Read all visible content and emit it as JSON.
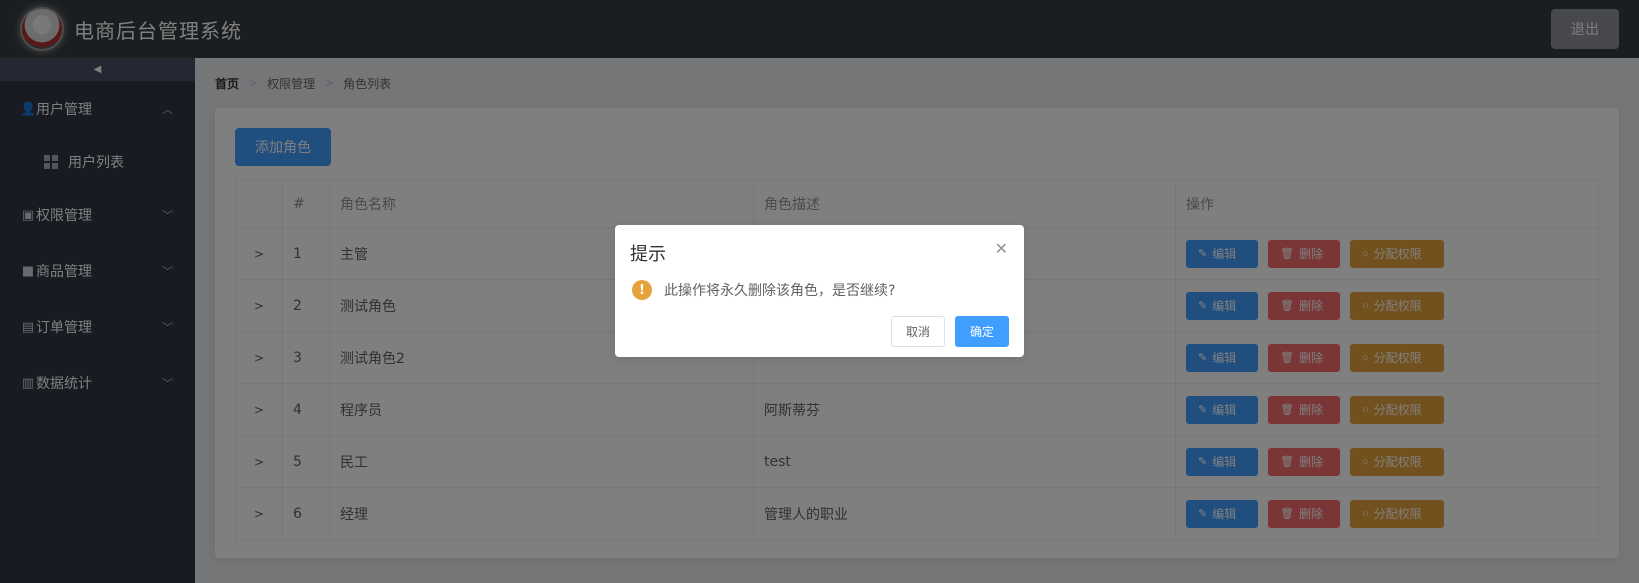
{
  "header": {
    "title": "电商后台管理系统",
    "logout_label": "退出"
  },
  "sidebar": {
    "collapse_icon": "caret-left-icon",
    "menus": [
      {
        "label": "用户管理",
        "icon": "user-icon",
        "expanded": true
      },
      {
        "label": "权限管理",
        "icon": "box-icon",
        "expanded": false
      },
      {
        "label": "商品管理",
        "icon": "bag-icon",
        "expanded": false
      },
      {
        "label": "订单管理",
        "icon": "clipboard-icon",
        "expanded": false
      },
      {
        "label": "数据统计",
        "icon": "chart-icon",
        "expanded": false
      }
    ],
    "submenu": {
      "label": "用户列表",
      "icon": "grid-icon"
    }
  },
  "breadcrumb": {
    "home": "首页",
    "level1": "权限管理",
    "level2": "角色列表"
  },
  "toolbar": {
    "add_label": "添加角色"
  },
  "table": {
    "headers": {
      "index": "#",
      "name": "角色名称",
      "desc": "角色描述",
      "ops": "操作"
    },
    "rows": [
      {
        "index": "1",
        "name": "主管",
        "desc": ""
      },
      {
        "index": "2",
        "name": "测试角色",
        "desc": ""
      },
      {
        "index": "3",
        "name": "测试角色2",
        "desc": ""
      },
      {
        "index": "4",
        "name": "程序员",
        "desc": "阿斯蒂芬"
      },
      {
        "index": "5",
        "name": "民工",
        "desc": "test"
      },
      {
        "index": "6",
        "name": "经理",
        "desc": "管理人的职业"
      }
    ],
    "ops": {
      "edit": "编辑",
      "delete": "删除",
      "assign": "分配权限"
    }
  },
  "dialog": {
    "title": "提示",
    "message": "此操作将永久删除该角色，是否继续?",
    "cancel_label": "取消",
    "confirm_label": "确定"
  },
  "colors": {
    "primary": "#409eff",
    "danger": "#f56c6c",
    "warning": "#e6a23c",
    "header_bg": "#373d41",
    "sidebar_bg": "#333744"
  }
}
